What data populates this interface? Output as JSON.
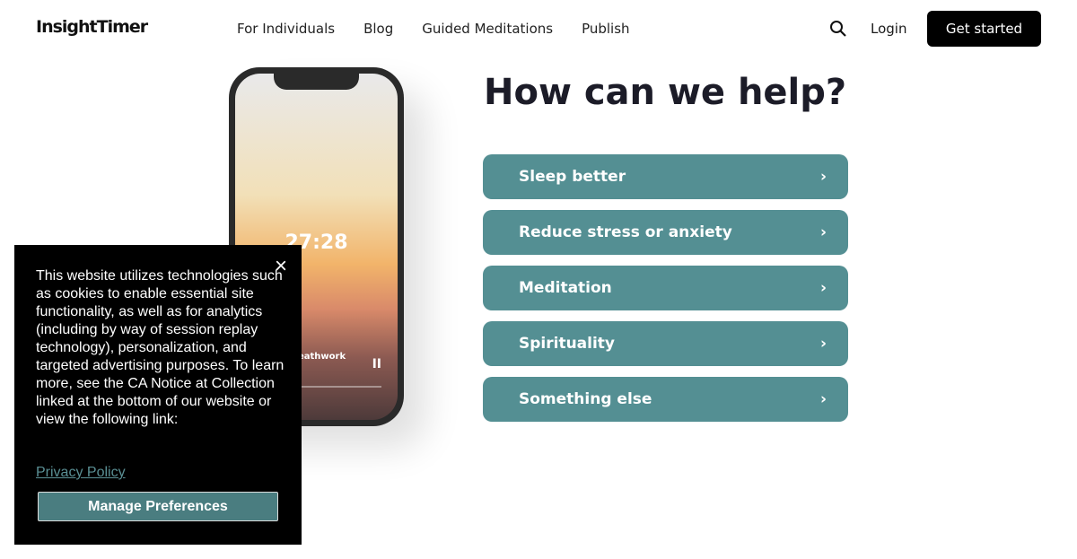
{
  "header": {
    "logo": "InsightTimer",
    "nav": [
      "For Individuals",
      "Blog",
      "Guided Meditations",
      "Publish"
    ],
    "login": "Login",
    "cta": "Get started"
  },
  "phone": {
    "time": "27:28",
    "track": "eathwork",
    "pause": "II"
  },
  "main": {
    "title": "How can we help?",
    "options": [
      "Sleep better",
      "Reduce stress or anxiety",
      "Meditation",
      "Spirituality",
      "Something else"
    ],
    "chevron": "›",
    "accent": "#548f93"
  },
  "cookie": {
    "text": "This website utilizes technologies such as cookies to enable essential site functionality, as well as for analytics (including by way of session replay technology), personalization, and targeted advertising purposes. To learn more, see the CA Notice at Collection linked at the bottom of our website or view the following link:",
    "close": "×",
    "privacy": "Privacy Policy",
    "manage": "Manage Preferences"
  }
}
